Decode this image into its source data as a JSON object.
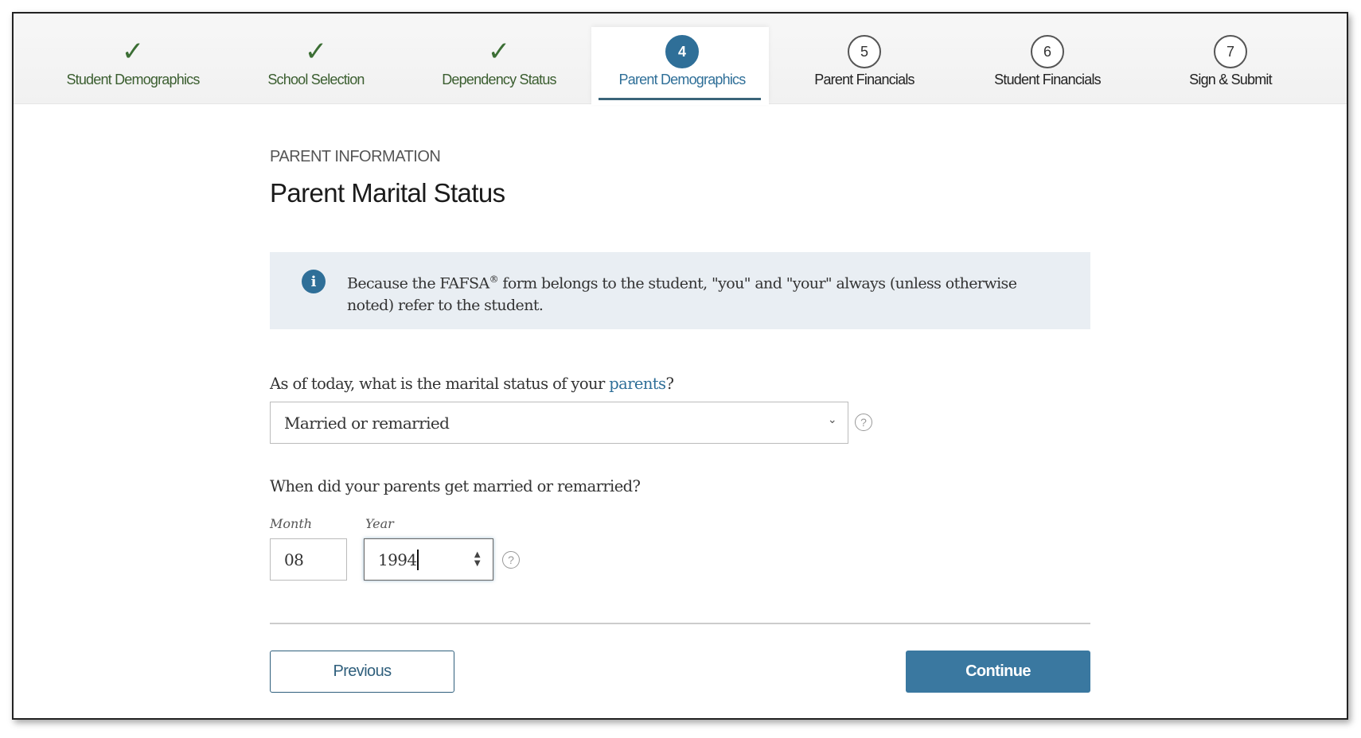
{
  "steps": [
    {
      "label": "Student Demographics",
      "status": "complete",
      "icon": "check-icon"
    },
    {
      "label": "School Selection",
      "status": "complete",
      "icon": "check-icon"
    },
    {
      "label": "Dependency Status",
      "status": "complete",
      "icon": "check-icon"
    },
    {
      "label": "Parent Demographics",
      "status": "current",
      "number": "4"
    },
    {
      "label": "Parent Financials",
      "status": "upcoming",
      "number": "5"
    },
    {
      "label": "Student Financials",
      "status": "upcoming",
      "number": "6"
    },
    {
      "label": "Sign & Submit",
      "status": "upcoming",
      "number": "7"
    }
  ],
  "page": {
    "kicker": "PARENT INFORMATION",
    "title": "Parent Marital Status"
  },
  "info": {
    "text_before": "Because the FAFSA",
    "sup": "®",
    "text_after": " form belongs to the student, \"you\" and \"your\" always (unless otherwise noted) refer to the student."
  },
  "q1": {
    "label_before": "As of today, what is the marital status of your ",
    "link": "parents",
    "label_after": "?",
    "value": "Married or remarried"
  },
  "q2": {
    "label": "When did your parents get married or remarried?",
    "month_label": "Month",
    "month_value": "08",
    "year_label": "Year",
    "year_value": "1994"
  },
  "buttons": {
    "previous": "Previous",
    "continue": "Continue"
  },
  "colors": {
    "primary": "#2f6f98",
    "complete": "#3b6e34",
    "info_bg": "#e9eef3"
  }
}
